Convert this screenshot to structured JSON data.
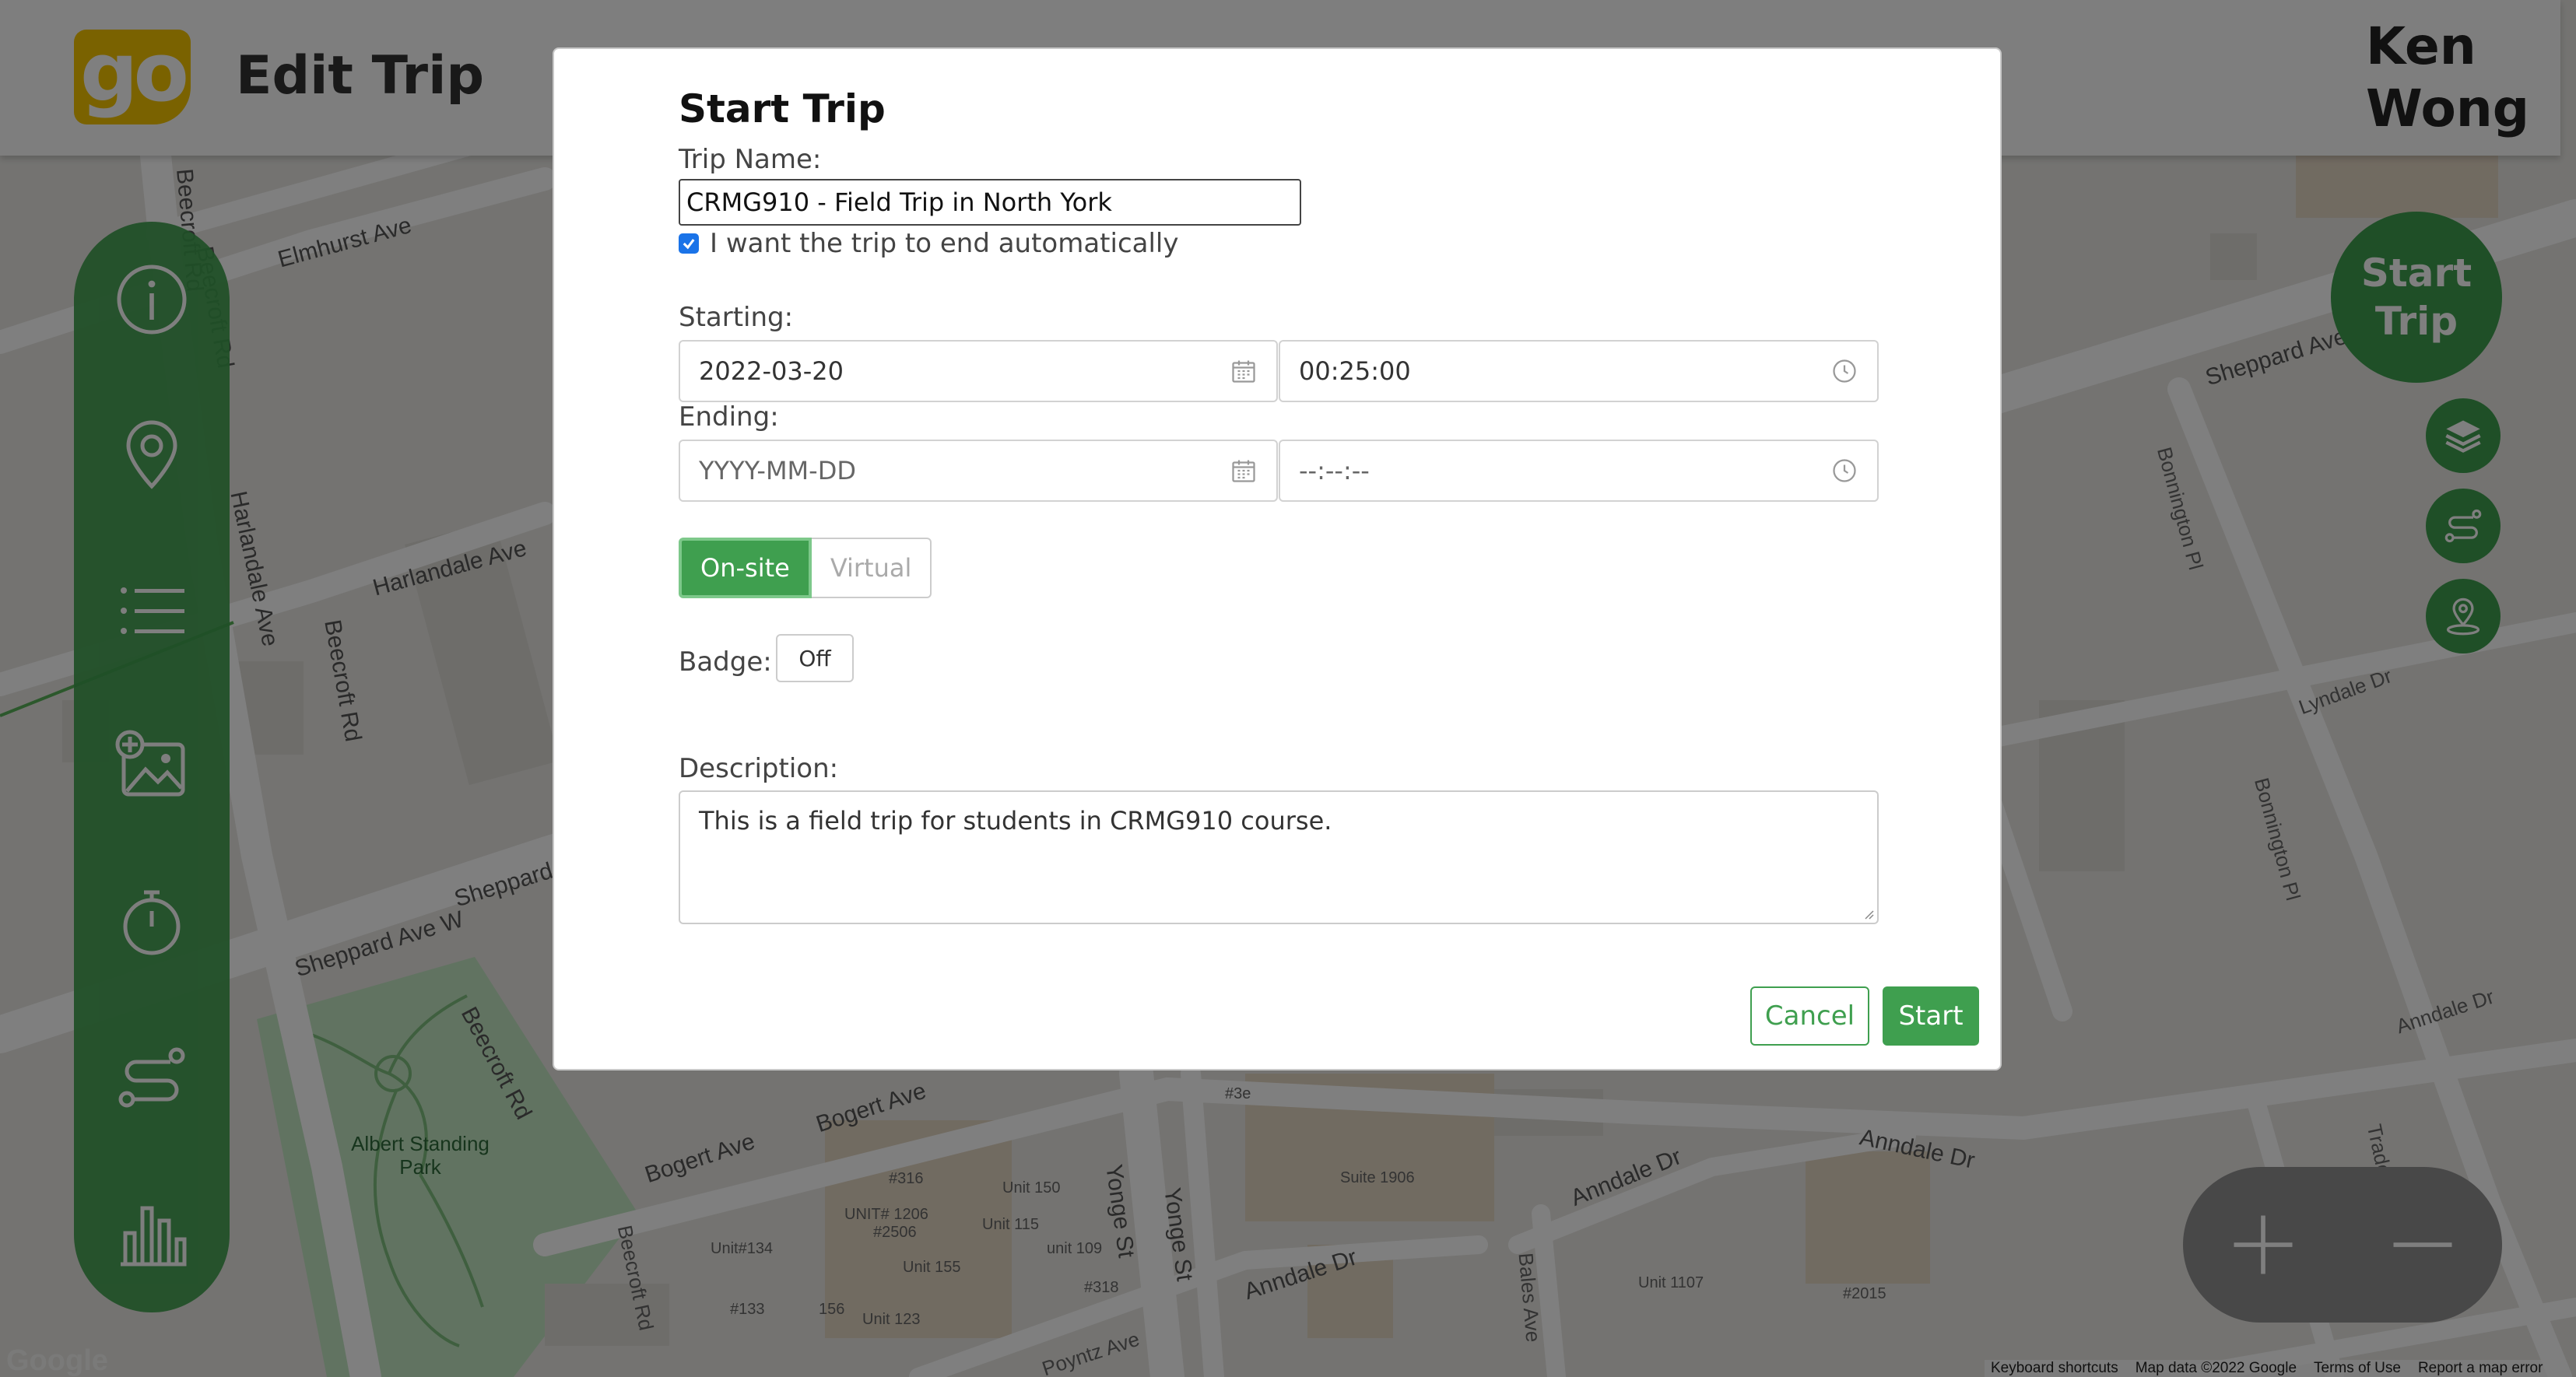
{
  "header": {
    "logo_text": "go",
    "title": "Edit Trip",
    "user_name": "Ken Wong"
  },
  "sidebar": {
    "items": [
      {
        "icon": "info-icon"
      },
      {
        "icon": "location-pin-icon"
      },
      {
        "icon": "list-icon"
      },
      {
        "icon": "add-image-icon"
      },
      {
        "icon": "timer-icon"
      },
      {
        "icon": "route-icon"
      },
      {
        "icon": "bar-chart-icon"
      }
    ]
  },
  "controls": {
    "start_trip_label": "Start Trip",
    "layers_icon": "layers-icon",
    "route_icon": "route-icon",
    "user_location_icon": "user-location-icon",
    "zoom_in_icon": "plus-icon",
    "zoom_out_icon": "minus-icon"
  },
  "modal": {
    "title": "Start Trip",
    "trip_name_label": "Trip Name:",
    "trip_name_value": "CRMG910 - Field Trip in North York",
    "auto_end_label": "I want the trip to end automatically",
    "auto_end_checked": true,
    "starting_label": "Starting:",
    "start_date": "2022-03-20",
    "start_time": "00:25:00",
    "ending_label": "Ending:",
    "end_date_placeholder": "YYYY-MM-DD",
    "end_time_placeholder": "--:--:--",
    "mode_options": [
      "On-site",
      "Virtual"
    ],
    "mode_selected": "On-site",
    "badge_label": "Badge:",
    "badge_value": "Off",
    "description_label": "Description:",
    "description_value": "This is a field trip for students in CRMG910 course.",
    "cancel_label": "Cancel",
    "start_label": "Start"
  },
  "map": {
    "labels": {
      "beecroft_rd": "Beecroft Rd",
      "elmhurst_ave": "Elmhurst Ave",
      "harlandale_ave": "Harlandale Ave",
      "sheppard_ave_w": "Sheppard Ave W",
      "sheppard_ave": "Sheppard Ave",
      "bonnington_pl": "Bonnington Pl",
      "lyndale_dr": "Lyndale Dr",
      "annandale_dr": "Anndale Dr",
      "bogert_ave": "Bogert Ave",
      "yonge_st": "Yonge St",
      "bales_ave": "Bales Ave",
      "tradewind_ave": "Tradewind Ave",
      "poyntz_ave": "Poyntz Ave",
      "park": "Albert Standing Park",
      "unit_316": "#316",
      "unit_150": "Unit 150",
      "unit_1206": "UNIT# 1206",
      "unit_2506": "#2506",
      "unit_115": "Unit 115",
      "unit_134": "Unit#134",
      "unit_155": "Unit 155",
      "unit_109": "unit 109",
      "unit_318": "#318",
      "unit_133": "#133",
      "unit_156": "156",
      "unit_123": "Unit 123",
      "suite_1906": "Suite 1906",
      "unit_3e": "#3e",
      "unit_1107": "Unit 1107",
      "unit_2015": "#2015"
    },
    "attribution": {
      "keyboard": "Keyboard shortcuts",
      "data": "Map data ©2022 Google",
      "terms": "Terms of Use",
      "report": "Report a map error"
    },
    "watermark": "Google"
  }
}
